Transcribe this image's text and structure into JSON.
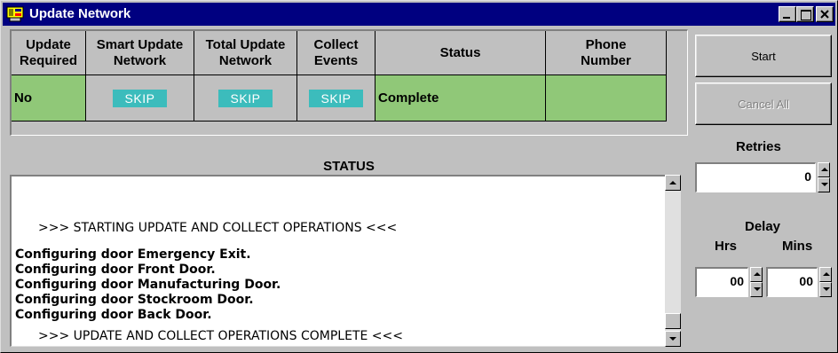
{
  "window": {
    "title": "Update Network"
  },
  "grid": {
    "headers": [
      "Update\nRequired",
      "Smart Update\nNetwork",
      "Total Update\nNetwork",
      "Collect\nEvents",
      "Status",
      "Phone\nNumber"
    ],
    "row": {
      "update_required": "No",
      "smart_update": "SKIP",
      "total_update": "SKIP",
      "collect_events": "SKIP",
      "status": "Complete",
      "phone_number": ""
    }
  },
  "buttons": {
    "start": "Start",
    "cancel_all": "Cancel All"
  },
  "retries": {
    "label": "Retries",
    "value": "0"
  },
  "delay": {
    "label": "Delay",
    "hrs_label": "Hrs",
    "mins_label": "Mins",
    "hrs_value": "00",
    "mins_value": "00"
  },
  "status": {
    "title": "STATUS",
    "lines": [
      ">>>  STARTING UPDATE AND COLLECT OPERATIONS  <<<",
      "Configuring door Emergency Exit.",
      "Configuring door Front Door.",
      "Configuring door Manufacturing Door.",
      "Configuring door Stockroom Door.",
      "Configuring door Back Door.",
      ">>>  UPDATE AND COLLECT OPERATIONS COMPLETE  <<<"
    ]
  },
  "colors": {
    "titlebar": "#000080",
    "row_green": "#90c878",
    "skip_badge": "#3cbcbc",
    "window_gray": "#c0c0c0"
  }
}
